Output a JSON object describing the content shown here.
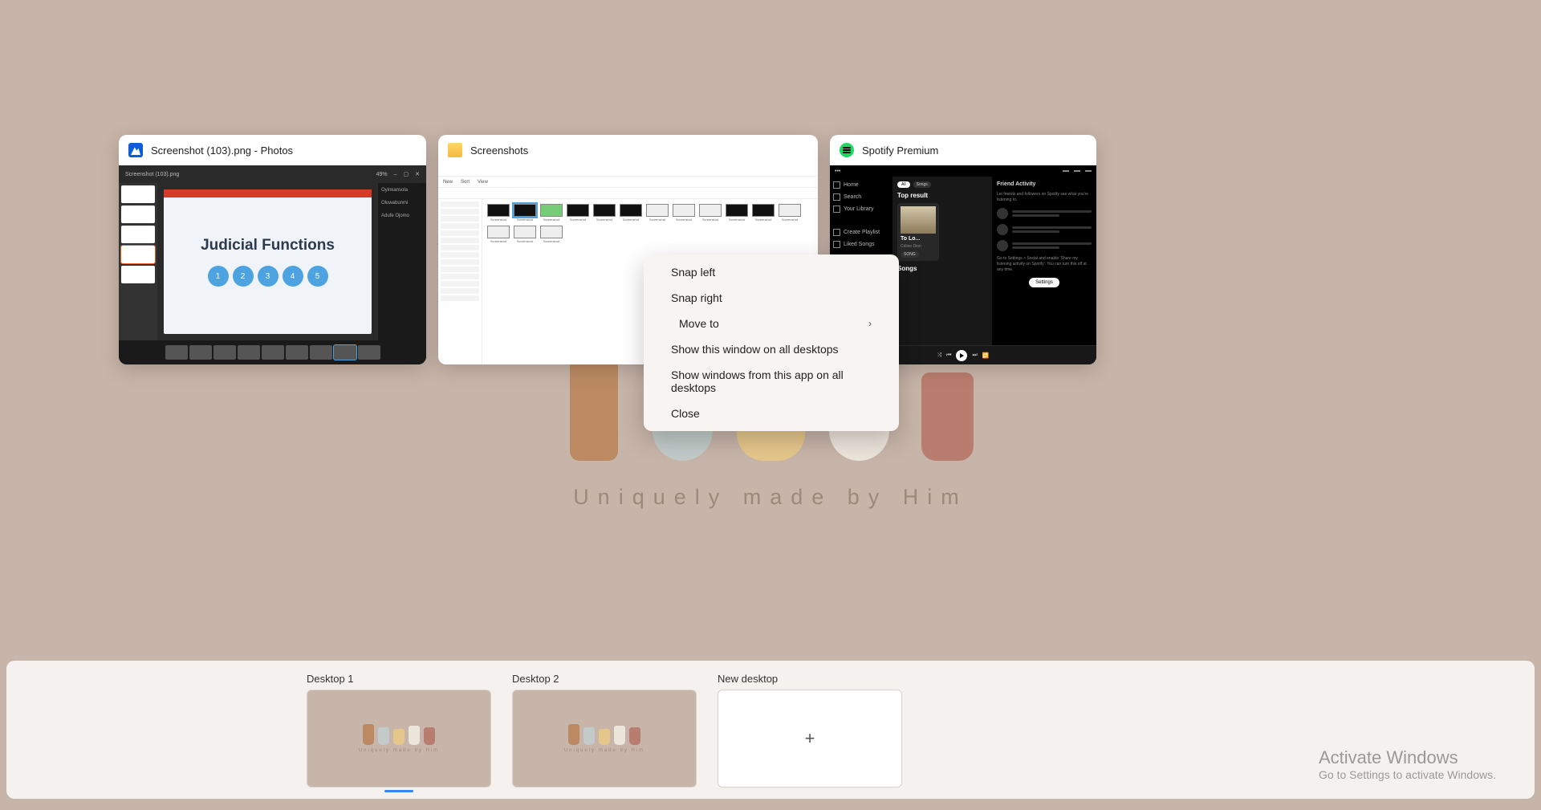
{
  "wallpaper": {
    "caption": "Uniquely made by Him"
  },
  "windows": [
    {
      "title": "Screenshot (103).png - Photos",
      "kind": "photos",
      "zoom": "49%",
      "slide_title": "Judicial Functions",
      "panel": {
        "a": "Oyinkansola",
        "b": "Oluwabunmi",
        "c": "Adufe Ojomo"
      }
    },
    {
      "title": "Screenshots",
      "kind": "folder"
    },
    {
      "title": "Spotify Premium",
      "kind": "spotify",
      "left": {
        "home": "Home",
        "search": "Search",
        "library": "Your Library",
        "create": "Create Playlist",
        "liked": "Liked Songs"
      },
      "center": {
        "songs_chip": "Songs",
        "top_result": "Top result",
        "card_title": "To Lo...",
        "card_sub": "Céline Dion",
        "card_pill": "SONG",
        "songs_heading": "Songs"
      },
      "right": {
        "heading": "Friend Activity",
        "blurb": "Let friends and followers on Spotify see what you're listening to.",
        "settings_hint": "Go to Settings > Social and enable 'Share my listening activity on Spotify'. You can turn this off at any time.",
        "settings_btn": "Settings"
      }
    }
  ],
  "context_menu": {
    "snap_left": "Snap left",
    "snap_right": "Snap right",
    "move_to": "Move to",
    "show_window_all": "Show this window on all desktops",
    "show_app_all": "Show windows from this app on all desktops",
    "close": "Close"
  },
  "desktops": {
    "d1": "Desktop 1",
    "d2": "Desktop 2",
    "new": "New desktop"
  },
  "activate": {
    "line1": "Activate Windows",
    "line2": "Go to Settings to activate Windows."
  }
}
